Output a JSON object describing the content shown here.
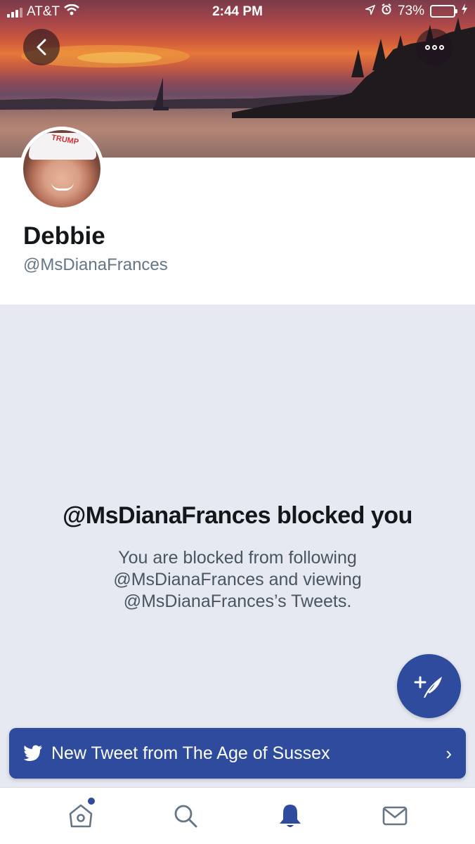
{
  "status_bar": {
    "carrier": "AT&T",
    "time": "2:44 PM",
    "battery_percent": "73%",
    "battery_level": 0.73
  },
  "header": {
    "back_icon": "chevron-left-icon",
    "more_icon": "more-dots-icon"
  },
  "profile": {
    "display_name": "Debbie",
    "handle": "@MsDianaFrances",
    "avatar_cap_text": "TRUMP"
  },
  "blocked": {
    "title": "@MsDianaFrances blocked you",
    "line1": "You are blocked from following",
    "line2": "@MsDianaFrances and viewing",
    "line3": "@MsDianaFrances’s Tweets."
  },
  "compose": {
    "icon": "compose-tweet-icon"
  },
  "toast": {
    "text": "New Tweet from The Age of Sussex",
    "icon": "twitter-bird-icon",
    "chevron": "›"
  },
  "tabbar": {
    "items": [
      {
        "name": "home",
        "icon": "home-icon",
        "has_dot": true,
        "active": false
      },
      {
        "name": "search",
        "icon": "search-icon",
        "active": false
      },
      {
        "name": "notifications",
        "icon": "bell-icon",
        "active": true
      },
      {
        "name": "messages",
        "icon": "mail-icon",
        "active": false
      }
    ]
  },
  "colors": {
    "accent": "#2e4b9d",
    "background": "#e6e9f1",
    "text_primary": "#14171a",
    "text_secondary": "#657786"
  }
}
